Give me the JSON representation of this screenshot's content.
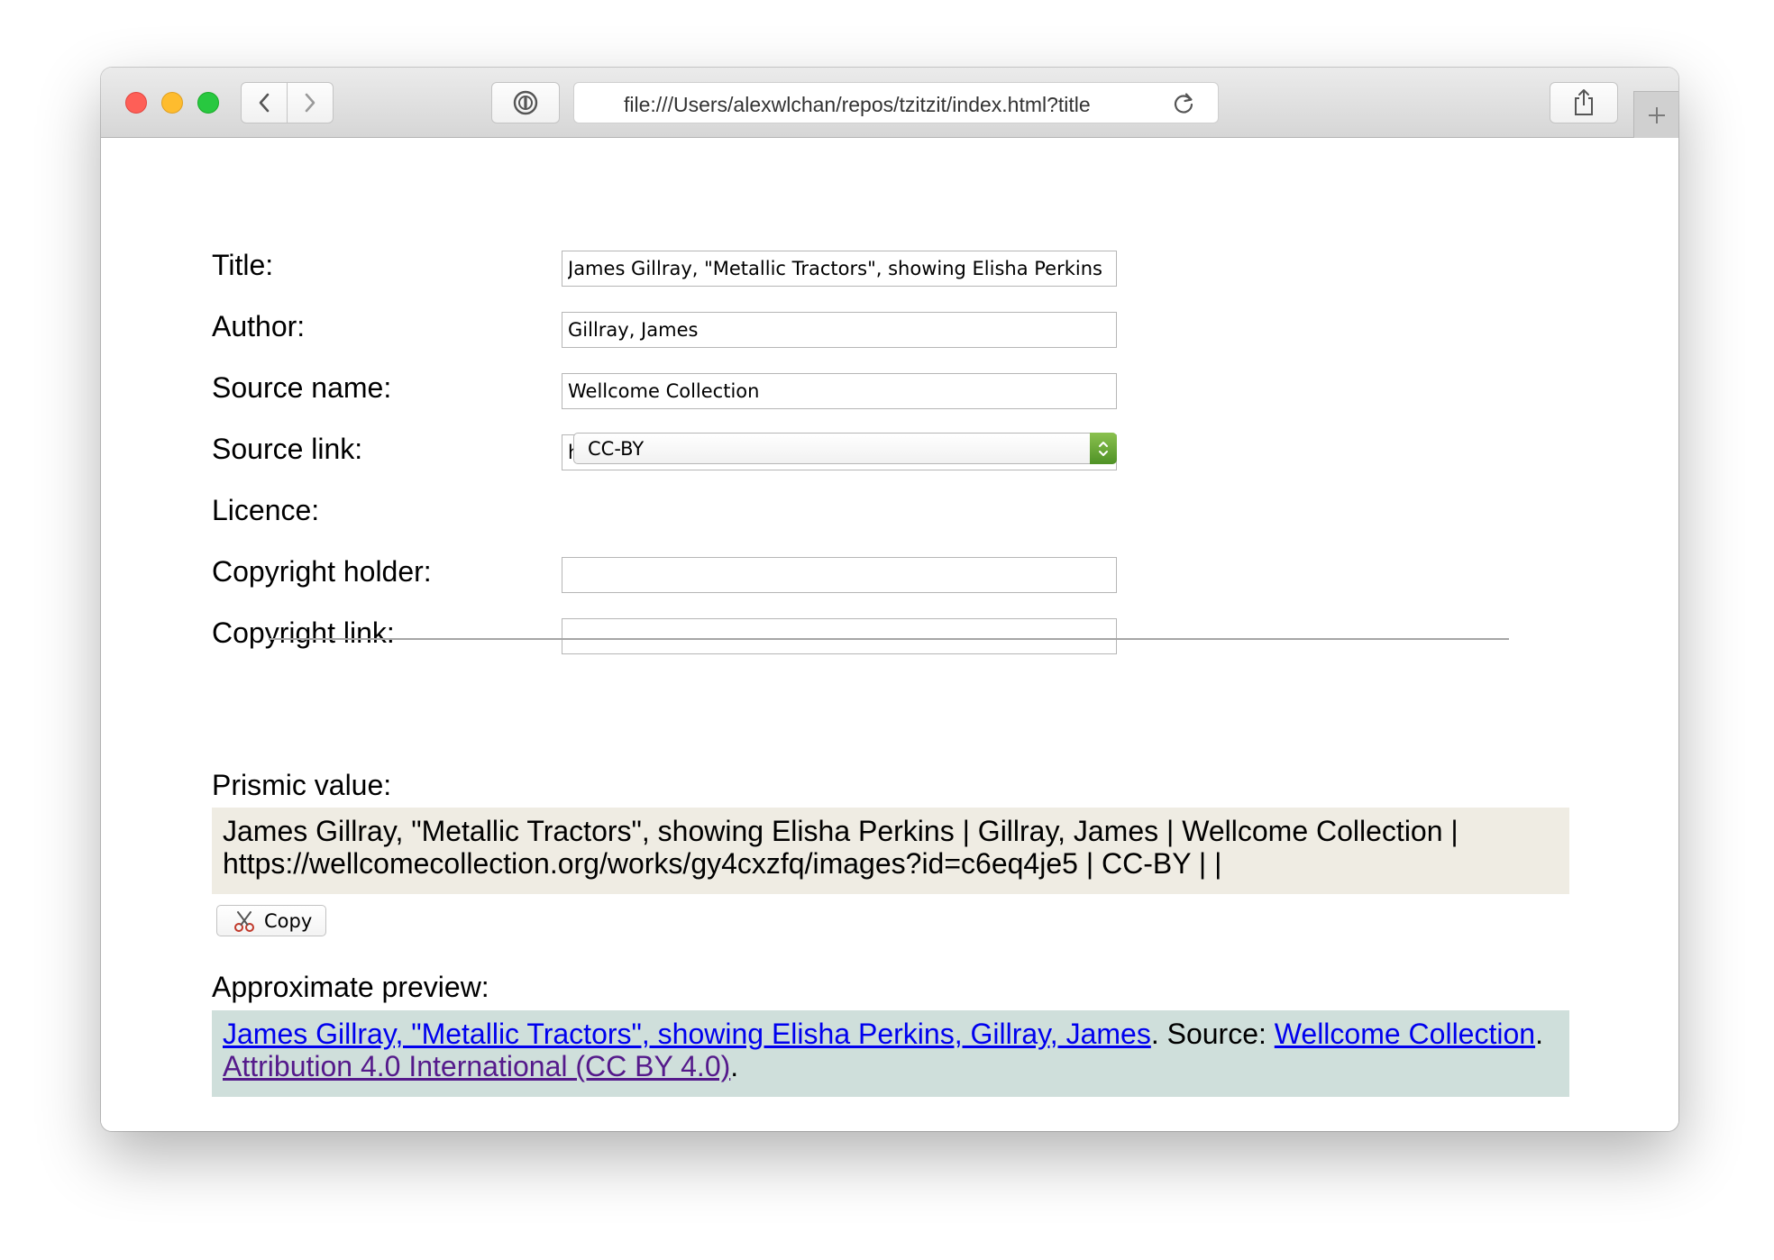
{
  "browser": {
    "url": "file:///Users/alexwlchan/repos/tzitzit/index.html?title",
    "icons": {
      "back": "chevron-left-icon",
      "forward": "chevron-right-icon",
      "extension": "password-manager-icon",
      "reload": "reload-icon",
      "share": "share-icon",
      "new_tab": "plus-icon"
    }
  },
  "form": {
    "title": {
      "label": "Title:",
      "value": "James Gillray, \"Metallic Tractors\", showing Elisha Perkins"
    },
    "author": {
      "label": "Author:",
      "value": "Gillray, James"
    },
    "source_name": {
      "label": "Source name:",
      "value": "Wellcome Collection"
    },
    "source_link": {
      "label": "Source link:",
      "value": "https://wellcomecollection.org/works/gy4cxzfq/images?id=c6eq4je5"
    },
    "licence": {
      "label": "Licence:",
      "selected": "CC-BY"
    },
    "copyright_holder": {
      "label": "Copyright holder:",
      "value": ""
    },
    "copyright_link": {
      "label": "Copyright link:",
      "value": ""
    }
  },
  "prismic": {
    "label": "Prismic value:",
    "line1": "James Gillray, \"Metallic Tractors\", showing Elisha Perkins | Gillray, James | Wellcome Collection |",
    "line2": "https://wellcomecollection.org/works/gy4cxzfq/images?id=c6eq4je5 | CC-BY | |",
    "copy_label": "Copy",
    "copy_icon": "scissors-icon"
  },
  "preview": {
    "label": "Approximate preview:",
    "title_link": "James Gillray, \"Metallic Tractors\", showing Elisha Perkins, Gillray, James",
    "source_prefix": ". Source: ",
    "source_link": "Wellcome Collection",
    "after_source": ".",
    "licence_link": "Attribution 4.0 International (CC BY 4.0)",
    "after_licence": "."
  },
  "colors": {
    "prismic_bg": "#efece3",
    "preview_bg": "#cfdfdb",
    "link": "#0000ee",
    "visited_link": "#551a8b"
  }
}
